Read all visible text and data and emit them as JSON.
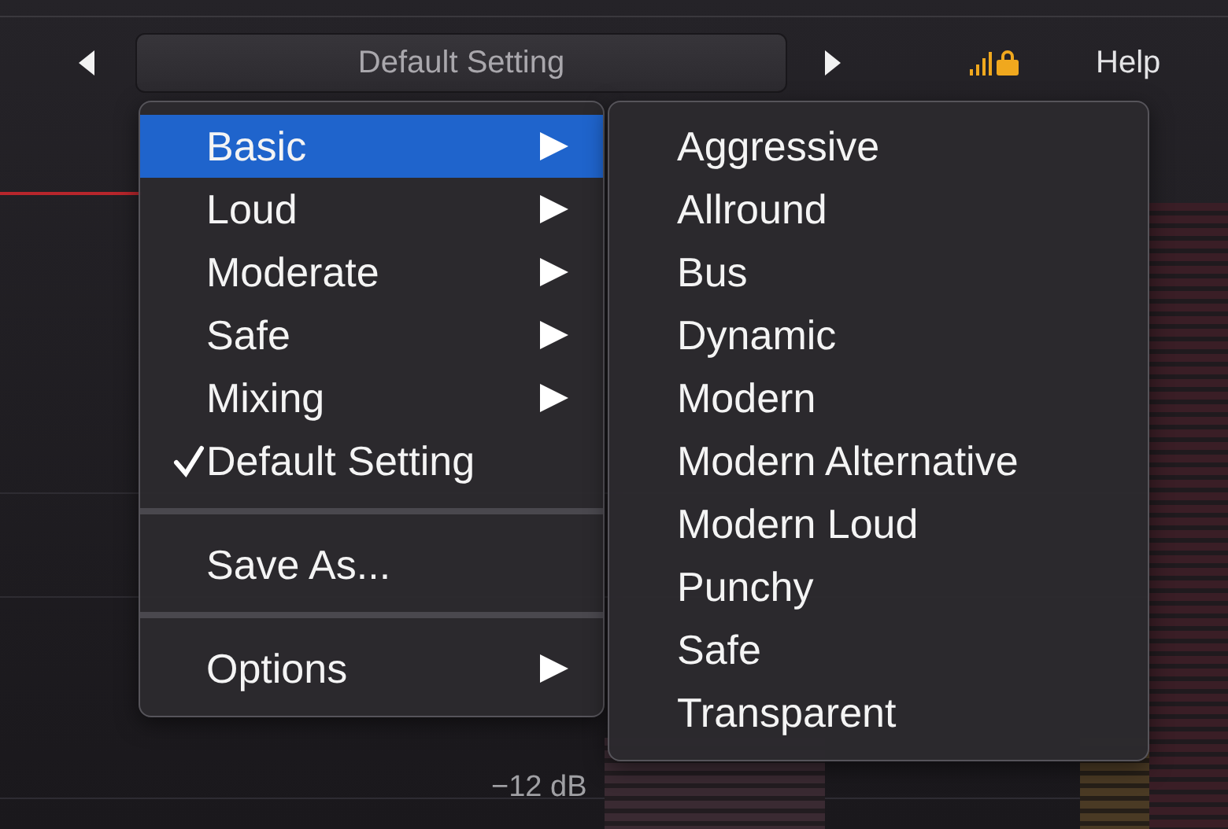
{
  "toolbar": {
    "preset_name": "Default Setting",
    "help": "Help"
  },
  "menu": {
    "items": [
      {
        "kind": "item",
        "label": "Basic",
        "selected": true,
        "checked": false,
        "submenu": true
      },
      {
        "kind": "item",
        "label": "Loud",
        "selected": false,
        "checked": false,
        "submenu": true
      },
      {
        "kind": "item",
        "label": "Moderate",
        "selected": false,
        "checked": false,
        "submenu": true
      },
      {
        "kind": "item",
        "label": "Safe",
        "selected": false,
        "checked": false,
        "submenu": true
      },
      {
        "kind": "item",
        "label": "Mixing",
        "selected": false,
        "checked": false,
        "submenu": true
      },
      {
        "kind": "item",
        "label": "Default Setting",
        "selected": false,
        "checked": true,
        "submenu": false
      },
      {
        "kind": "separator"
      },
      {
        "kind": "item",
        "label": "Save As...",
        "selected": false,
        "checked": false,
        "submenu": false
      },
      {
        "kind": "separator"
      },
      {
        "kind": "item",
        "label": "Options",
        "selected": false,
        "checked": false,
        "submenu": true
      }
    ]
  },
  "submenu": {
    "items": [
      {
        "label": "Aggressive",
        "selected": false
      },
      {
        "label": "Allround",
        "selected": false
      },
      {
        "label": "Bus",
        "selected": false
      },
      {
        "label": "Dynamic",
        "selected": false
      },
      {
        "label": "Modern",
        "selected": false
      },
      {
        "label": "Modern Alternative",
        "selected": false
      },
      {
        "label": "Modern Loud",
        "selected": false
      },
      {
        "label": "Punchy",
        "selected": false
      },
      {
        "label": "Safe",
        "selected": false
      },
      {
        "label": "Transparent",
        "selected": false
      }
    ]
  },
  "scale_label": "−12 dB"
}
